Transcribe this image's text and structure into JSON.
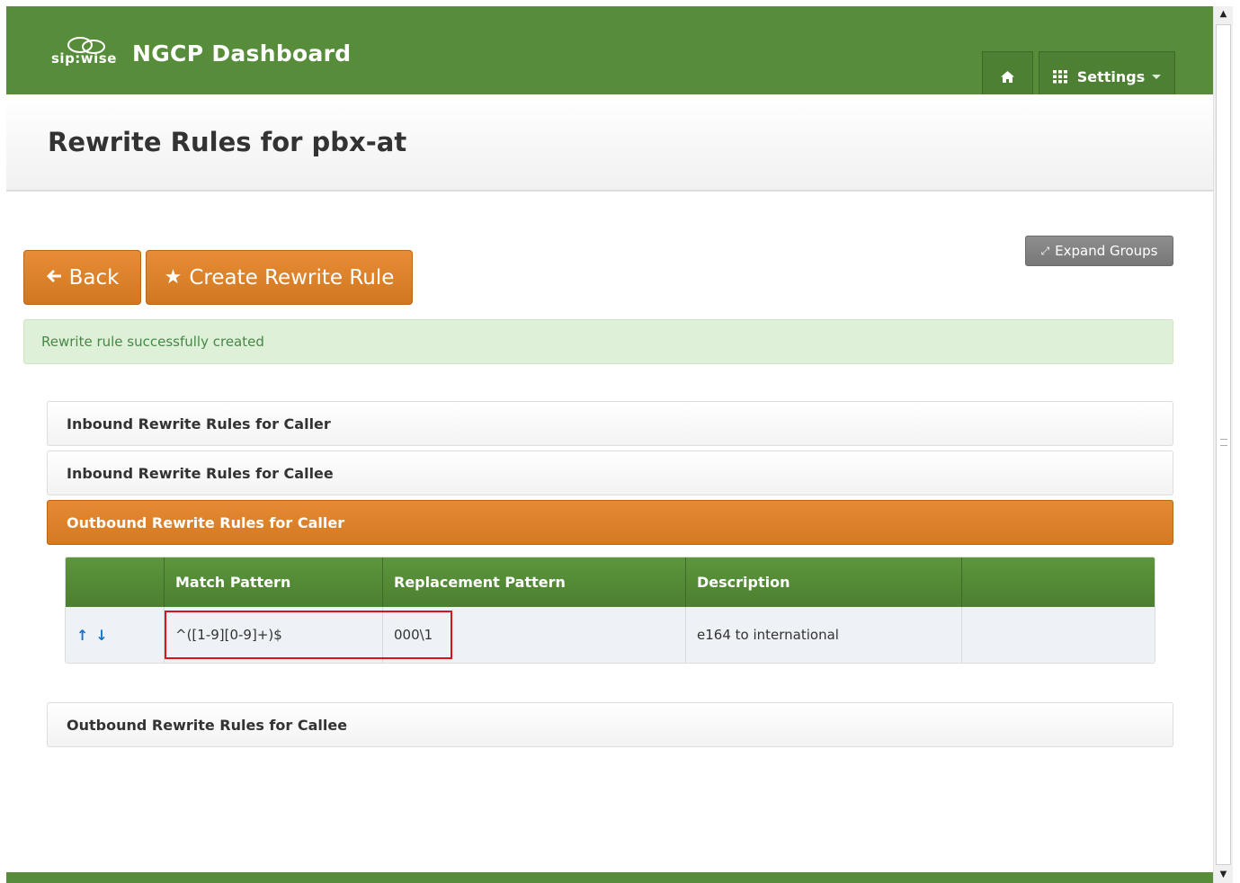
{
  "navbar": {
    "logo_text": "sip:wise",
    "title": "NGCP Dashboard",
    "home_icon": "home-icon",
    "settings_icon": "grid-icon",
    "settings_label": "Settings",
    "color": "#578d3a"
  },
  "header": {
    "title": "Rewrite Rules for pbx-at"
  },
  "actions": {
    "back_label": "Back",
    "back_icon": "arrow-left-icon",
    "create_label": "Create Rewrite Rule",
    "create_icon": "star-icon",
    "expand_label": "Expand Groups",
    "expand_icon": "expand-icon"
  },
  "alert": {
    "message": "Rewrite rule successfully created"
  },
  "groups": [
    {
      "label": "Inbound Rewrite Rules for Caller",
      "expanded": false
    },
    {
      "label": "Inbound Rewrite Rules for Callee",
      "expanded": false
    },
    {
      "label": "Outbound Rewrite Rules for Caller",
      "expanded": true
    },
    {
      "label": "Outbound Rewrite Rules for Callee",
      "expanded": false
    }
  ],
  "table": {
    "columns": [
      "",
      "Match Pattern",
      "Replacement Pattern",
      "Description",
      ""
    ],
    "rows": [
      {
        "up_icon": "arrow-up-icon",
        "down_icon": "arrow-down-icon",
        "match_pattern": "^([1-9][0-9]+)$",
        "replacement_pattern": "000\\1",
        "description": "e164 to international",
        "actions": ""
      }
    ]
  },
  "colors": {
    "brand_green": "#578d3a",
    "accent_orange": "#d98127",
    "alert_bg": "#dff0d8",
    "highlight_red": "#e0101a"
  }
}
